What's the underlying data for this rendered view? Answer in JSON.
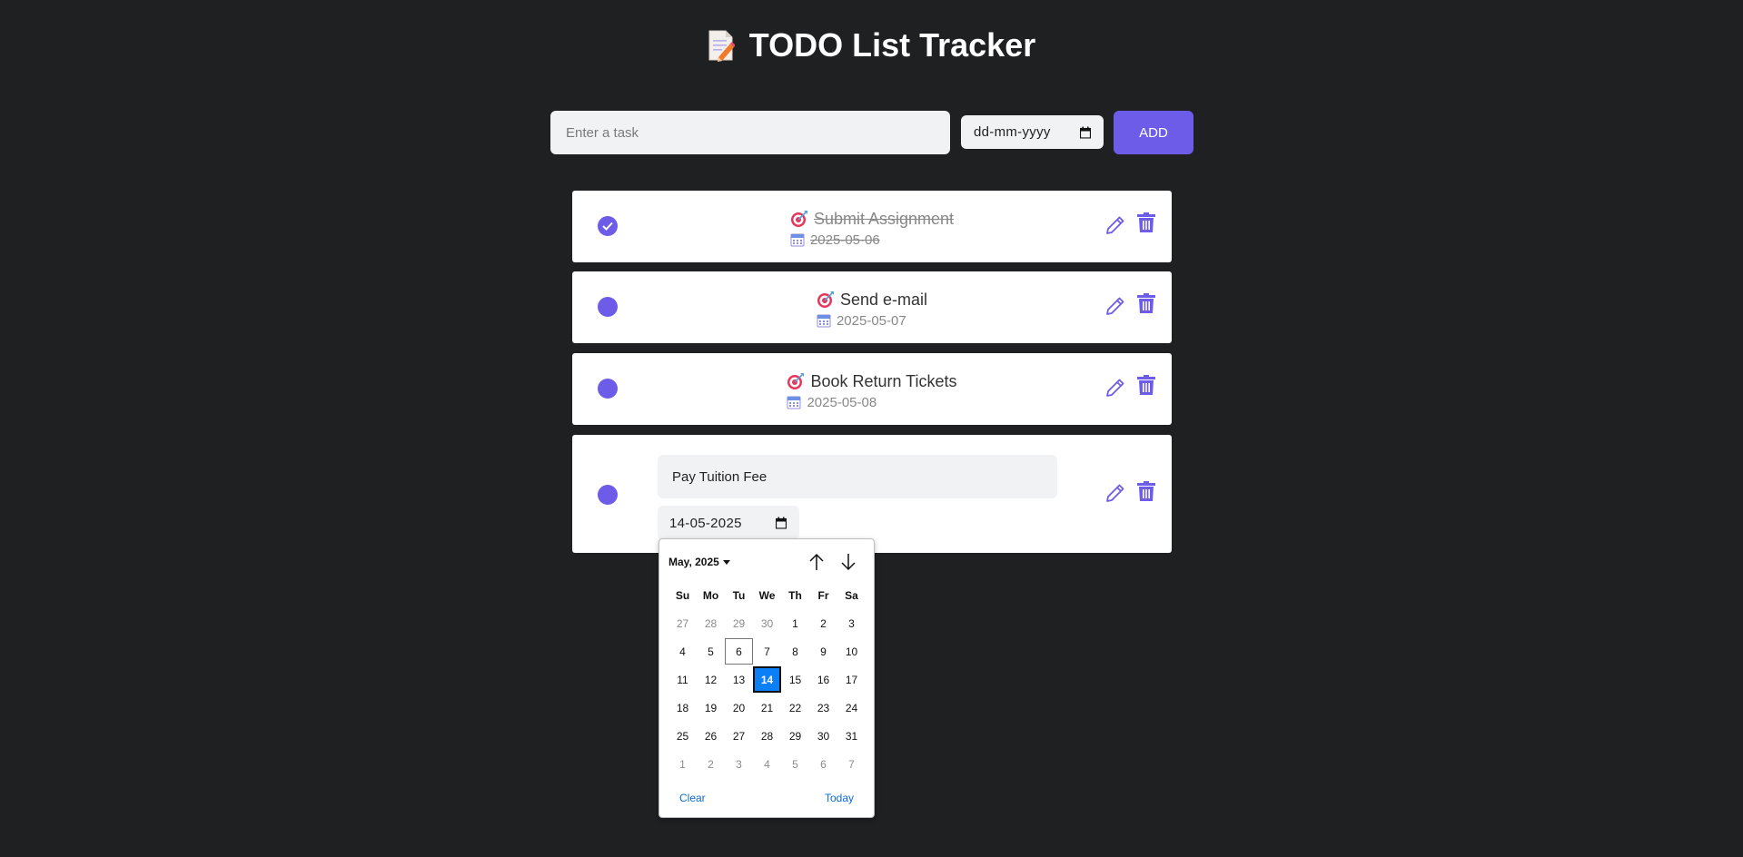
{
  "header": {
    "title": "TODO List Tracker",
    "icon": "memo-icon"
  },
  "add_bar": {
    "task_placeholder": "Enter a task",
    "task_value": "",
    "date_placeholder": "dd-mm-yyyy",
    "add_label": "ADD"
  },
  "tasks": [
    {
      "title": "Submit Assignment",
      "date": "2025-05-06",
      "completed": true
    },
    {
      "title": "Send e-mail",
      "date": "2025-05-07",
      "completed": false
    },
    {
      "title": "Book Return Tickets",
      "date": "2025-05-08",
      "completed": false
    }
  ],
  "editing_task": {
    "title_value": "Pay Tuition Fee",
    "date_value": "14-05-2025"
  },
  "date_picker": {
    "month_label": "May, 2025",
    "weekdays": [
      "Su",
      "Mo",
      "Tu",
      "We",
      "Th",
      "Fr",
      "Sa"
    ],
    "weeks": [
      [
        "27",
        "28",
        "29",
        "30",
        "1",
        "2",
        "3"
      ],
      [
        "4",
        "5",
        "6",
        "7",
        "8",
        "9",
        "10"
      ],
      [
        "11",
        "12",
        "13",
        "14",
        "15",
        "16",
        "17"
      ],
      [
        "18",
        "19",
        "20",
        "21",
        "22",
        "23",
        "24"
      ],
      [
        "25",
        "26",
        "27",
        "28",
        "29",
        "30",
        "31"
      ],
      [
        "1",
        "2",
        "3",
        "4",
        "5",
        "6",
        "7"
      ]
    ],
    "today": "6",
    "selected": "14",
    "clear_label": "Clear",
    "today_label": "Today"
  },
  "colors": {
    "background": "#1f2022",
    "accent": "#6c5ce7",
    "card": "#ffffff",
    "input": "#f1f2f4",
    "picker_selected": "#0b7ff5"
  }
}
